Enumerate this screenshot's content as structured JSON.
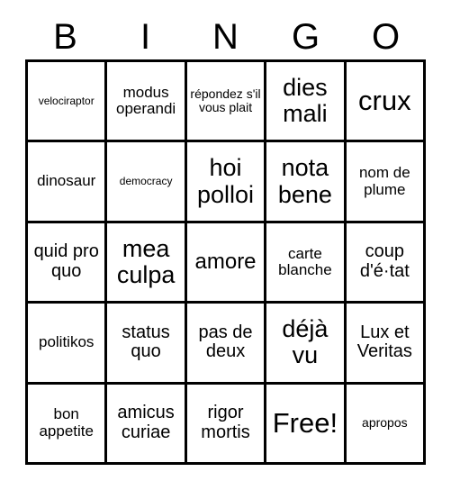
{
  "card": {
    "title": "BINGO",
    "header_letters": [
      "B",
      "I",
      "N",
      "G",
      "O"
    ],
    "columns": 5,
    "rows": 5,
    "colors": {
      "background": "#ffffff",
      "text": "#000000",
      "grid_line": "#000000"
    },
    "free_space": {
      "label": "Free!",
      "row": 5,
      "column": 4
    },
    "grid": [
      [
        {
          "text": "velociraptor",
          "size": "xxs"
        },
        {
          "text": "modus operandi",
          "size": "sm"
        },
        {
          "text": "répondez s'il vous plait",
          "size": "xs"
        },
        {
          "text": "dies mali",
          "size": "xl"
        },
        {
          "text": "crux",
          "size": "xxl"
        }
      ],
      [
        {
          "text": "dinosaur",
          "size": "sm"
        },
        {
          "text": "democracy",
          "size": "xxs"
        },
        {
          "text": "hoi polloi",
          "size": "xl"
        },
        {
          "text": "nota bene",
          "size": "xl"
        },
        {
          "text": "nom de plume",
          "size": "sm"
        }
      ],
      [
        {
          "text": "quid pro quo",
          "size": "md"
        },
        {
          "text": "mea culpa",
          "size": "xl"
        },
        {
          "text": "amore",
          "size": "lg"
        },
        {
          "text": "carte blanche",
          "size": "sm"
        },
        {
          "text": "coup d'é·tat",
          "size": "md"
        }
      ],
      [
        {
          "text": "politikos",
          "size": "sm"
        },
        {
          "text": "status quo",
          "size": "md"
        },
        {
          "text": "pas de deux",
          "size": "md"
        },
        {
          "text": "déjà vu",
          "size": "xl"
        },
        {
          "text": "Lux et Veritas",
          "size": "md"
        }
      ],
      [
        {
          "text": "bon appetite",
          "size": "sm"
        },
        {
          "text": "amicus curiae",
          "size": "md"
        },
        {
          "text": "rigor mortis",
          "size": "md"
        },
        {
          "text": "Free!",
          "size": "xxl"
        },
        {
          "text": "apropos",
          "size": "xs"
        }
      ]
    ]
  }
}
